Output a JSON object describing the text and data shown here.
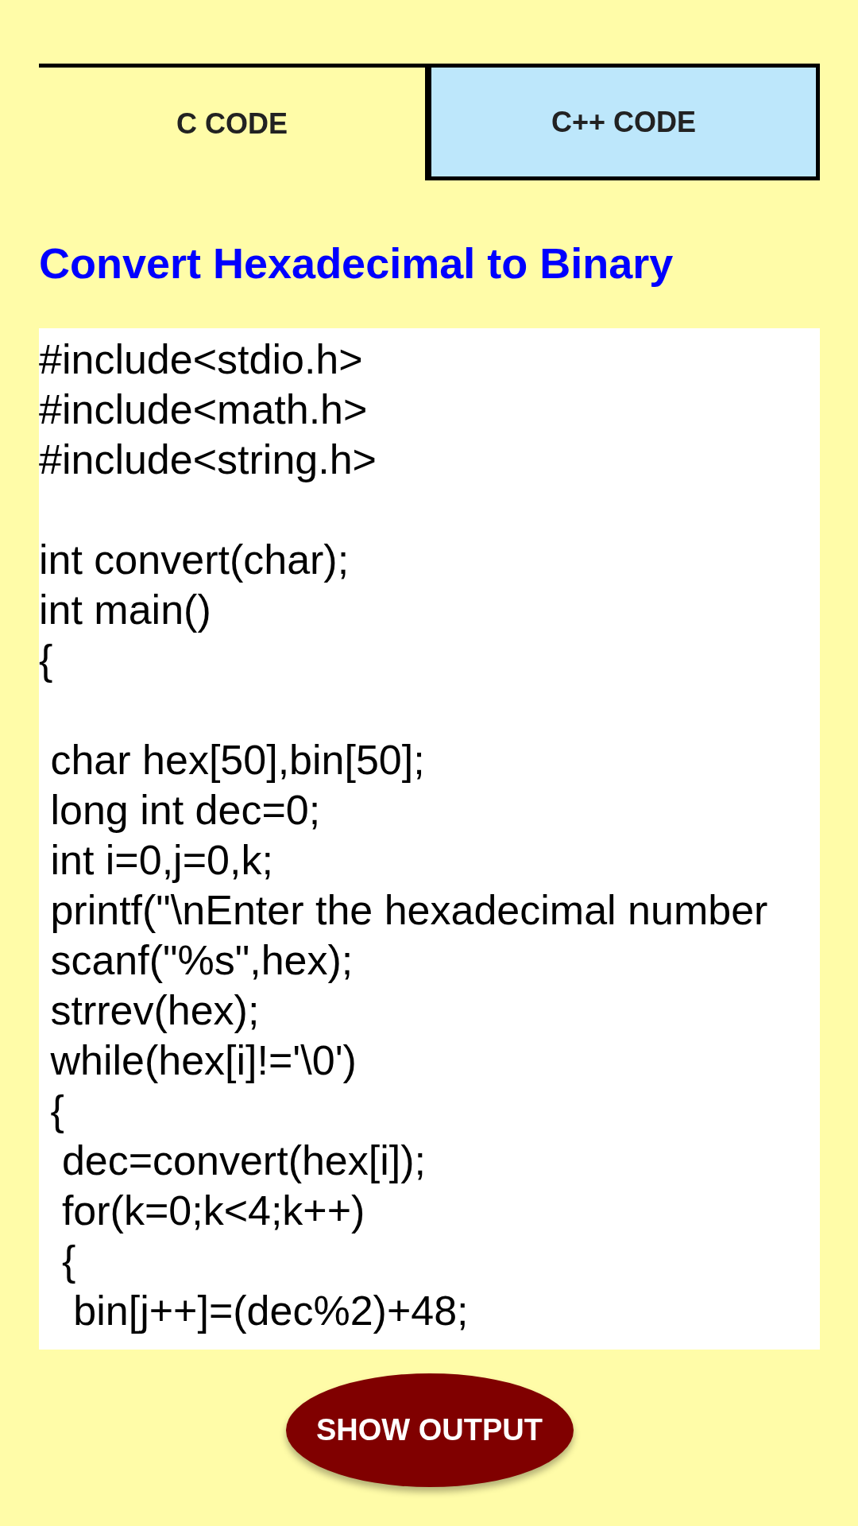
{
  "tabs": [
    {
      "label": "C CODE",
      "selected": true
    },
    {
      "label": "C++ CODE",
      "selected": false
    }
  ],
  "title": "Convert Hexadecimal to Binary",
  "code_blocks": [
    [
      "#include<stdio.h>",
      "#include<math.h>",
      "#include<string.h>"
    ],
    [
      "int convert(char);",
      "int main()",
      "{"
    ],
    [
      " char hex[50],bin[50];",
      " long int dec=0;",
      " int i=0,j=0,k;",
      " printf(\"\\nEnter the hexadecimal number",
      " scanf(\"%s\",hex);",
      " strrev(hex);",
      " while(hex[i]!='\\0')",
      " {",
      "  dec=convert(hex[i]);",
      "  for(k=0;k<4;k++)",
      "  {",
      "   bin[j++]=(dec%2)+48;"
    ]
  ],
  "button": "SHOW OUTPUT"
}
